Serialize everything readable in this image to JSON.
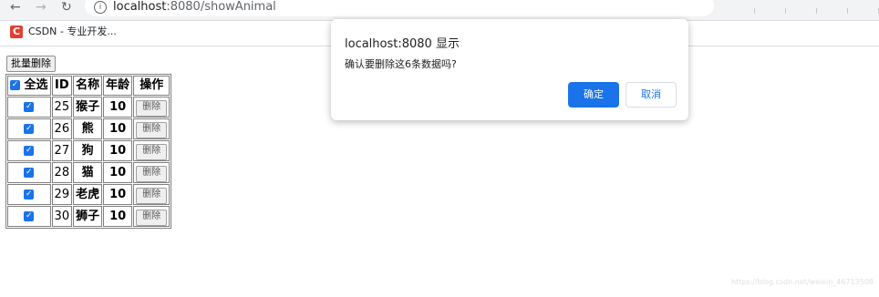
{
  "browser": {
    "url_host": "localhost",
    "url_port_path": ":8080/showAnimal",
    "bookmark": "CSDN - 专业开发..."
  },
  "page": {
    "batch_delete_label": "批量删除",
    "headers": [
      "全选",
      "ID",
      "名称",
      "年龄",
      "操作"
    ],
    "rows": [
      {
        "id": "25",
        "name": "猴子",
        "age": "10",
        "action": "删除"
      },
      {
        "id": "26",
        "name": "熊",
        "age": "10",
        "action": "删除"
      },
      {
        "id": "27",
        "name": "狗",
        "age": "10",
        "action": "删除"
      },
      {
        "id": "28",
        "name": "猫",
        "age": "10",
        "action": "删除"
      },
      {
        "id": "29",
        "name": "老虎",
        "age": "10",
        "action": "删除"
      },
      {
        "id": "30",
        "name": "狮子",
        "age": "10",
        "action": "删除"
      }
    ]
  },
  "dialog": {
    "title": "localhost:8080 显示",
    "message": "确认要删除这6条数据吗?",
    "ok_label": "确定",
    "cancel_label": "取消"
  },
  "watermark": "https://blog.csdn.net/weixin_46713508",
  "colors": {
    "accent": "#1a73e8",
    "brand": "#e33e33"
  }
}
